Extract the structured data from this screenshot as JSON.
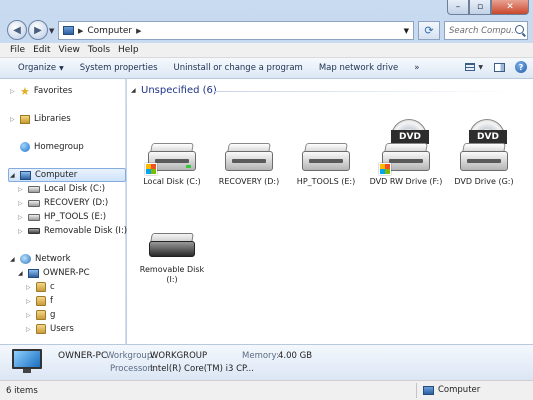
{
  "window": {
    "address_path": "Computer",
    "search_placeholder": "Search Compu...",
    "caption_buttons": {
      "minimize": "–",
      "maximize": "▫",
      "close": "✕"
    }
  },
  "menu": [
    "File",
    "Edit",
    "View",
    "Tools",
    "Help"
  ],
  "commands": {
    "organize": "Organize",
    "system_properties": "System properties",
    "uninstall": "Uninstall or change a program",
    "map_network": "Map network drive",
    "more": "»"
  },
  "nav": {
    "favorites": "Favorites",
    "libraries": "Libraries",
    "homegroup": "Homegroup",
    "computer": "Computer",
    "computer_children": [
      "Local Disk (C:)",
      "RECOVERY (D:)",
      "HP_TOOLS (E:)",
      "Removable Disk (I:)"
    ],
    "network": "Network",
    "owner_pc": "OWNER-PC",
    "owner_children": [
      "c",
      "f",
      "g",
      "Users"
    ]
  },
  "content": {
    "group_header": "Unspecified (6)",
    "items": [
      {
        "label": "Local Disk (C:)",
        "icon": "hard-disk-icon"
      },
      {
        "label": "RECOVERY (D:)",
        "icon": "hard-disk-icon"
      },
      {
        "label": "HP_TOOLS (E:)",
        "icon": "hard-disk-icon"
      },
      {
        "label": "DVD RW Drive (F:)",
        "icon": "dvd-drive-icon",
        "badge": "DVD"
      },
      {
        "label": "DVD Drive (G:)",
        "icon": "dvd-drive-icon",
        "badge": "DVD"
      },
      {
        "label": "Removable Disk (I:)",
        "icon": "removable-disk-icon"
      }
    ]
  },
  "details": {
    "name": "OWNER-PC",
    "workgroup_label": "Workgroup:",
    "workgroup": "WORKGROUP",
    "memory_label": "Memory:",
    "memory": "4.00 GB",
    "processor_label": "Processor:",
    "processor": "Intel(R) Core(TM) i3 CP..."
  },
  "status": {
    "items": "6 items",
    "location": "Computer"
  }
}
